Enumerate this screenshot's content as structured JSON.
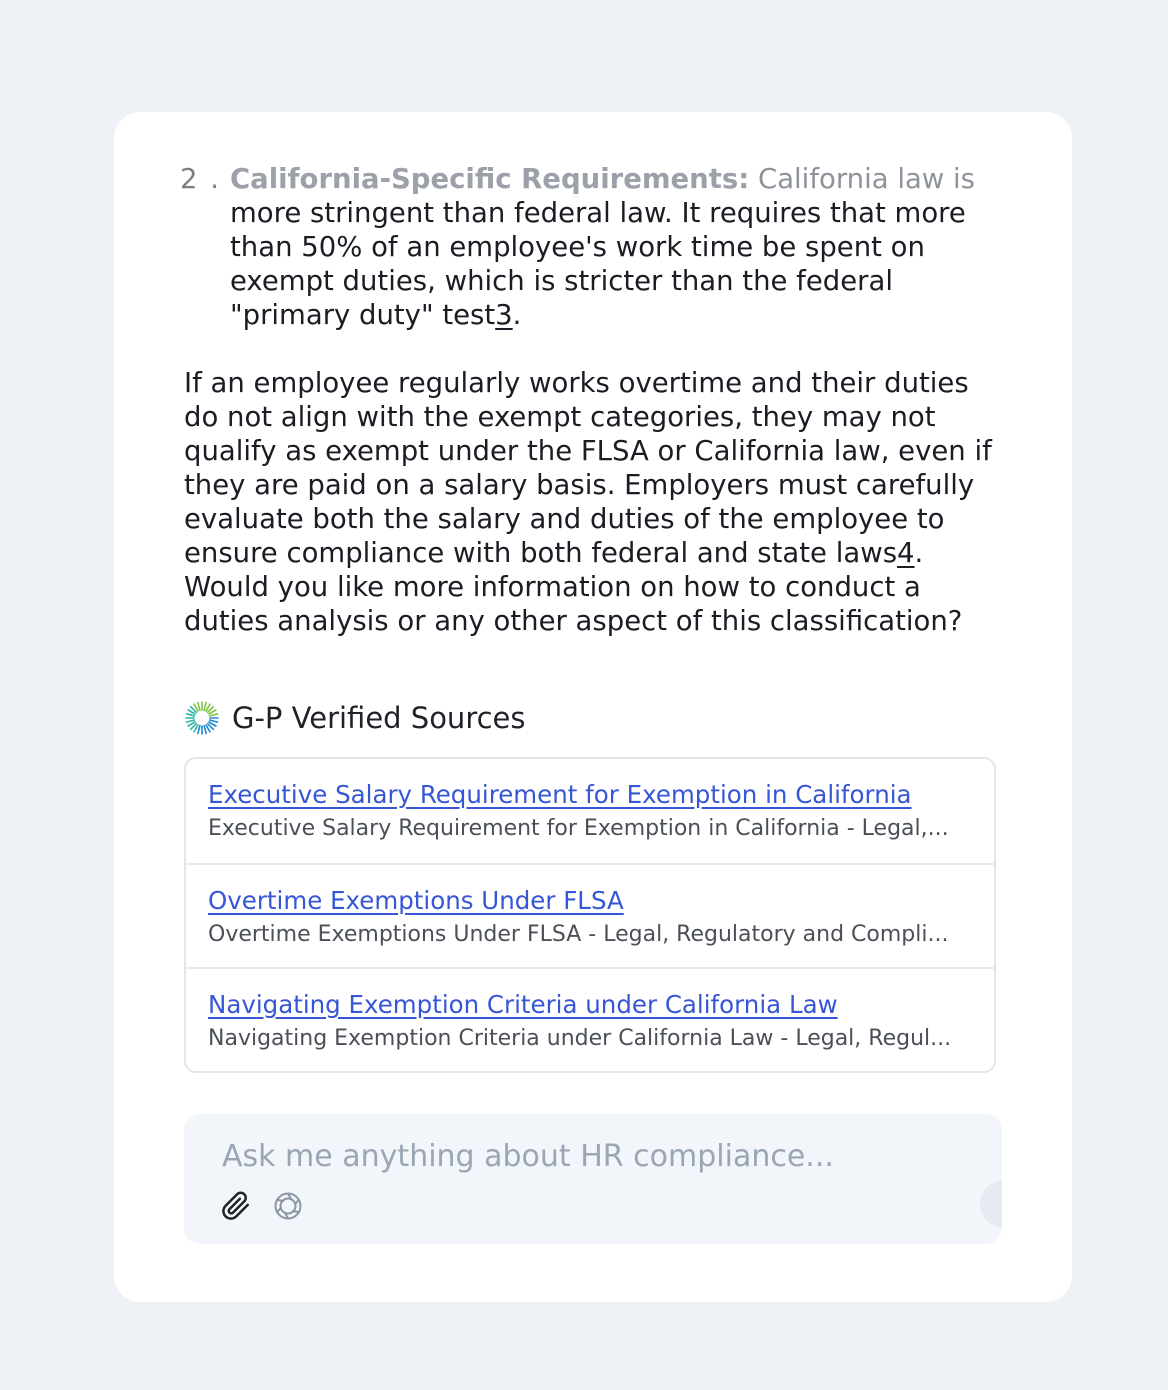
{
  "answer": {
    "list_item": {
      "number": "2 .",
      "lead": "California-Specific Requirements:",
      "first_line_rest": " California law is",
      "body": " more stringent than federal law. It requires that more than 50% of an employee's work time be spent on exempt duties, which is stricter than the federal \"primary duty\" test",
      "cite": "3",
      "end": "."
    },
    "paragraph": {
      "text": "If an employee regularly works overtime and their duties do not align with the exempt categories, they may not qualify as exempt under the FLSA or California law, even if they are paid on a salary basis. Employers must carefully evaluate both the salary and duties of the employee to ensure compliance with both federal and state laws",
      "cite": "4",
      "end": ". Would you like more information on how to conduct a duties analysis or any other aspect of this classification?"
    }
  },
  "sources": {
    "title": "G-P Verified Sources",
    "icon": "burst-logo-icon",
    "items": [
      {
        "title": "Executive Salary Requirement for Exemption in California",
        "description": "Executive Salary Requirement for Exemption in California - Legal,..."
      },
      {
        "title": "Overtime Exemptions Under FLSA",
        "description": "Overtime Exemptions Under FLSA - Legal, Regulatory and Compli..."
      },
      {
        "title": "Navigating Exemption Criteria under California Law",
        "description": "Navigating Exemption Criteria under California Law - Legal, Regul..."
      }
    ]
  },
  "composer": {
    "placeholder": "Ask me anything about HR compliance...",
    "value": "",
    "attach_icon": "paperclip-icon",
    "second_icon": "aperture-icon"
  },
  "colors": {
    "link": "#3756d6",
    "background": "#eef1f6",
    "card": "#ffffff",
    "composer": "#f2f5f9"
  }
}
